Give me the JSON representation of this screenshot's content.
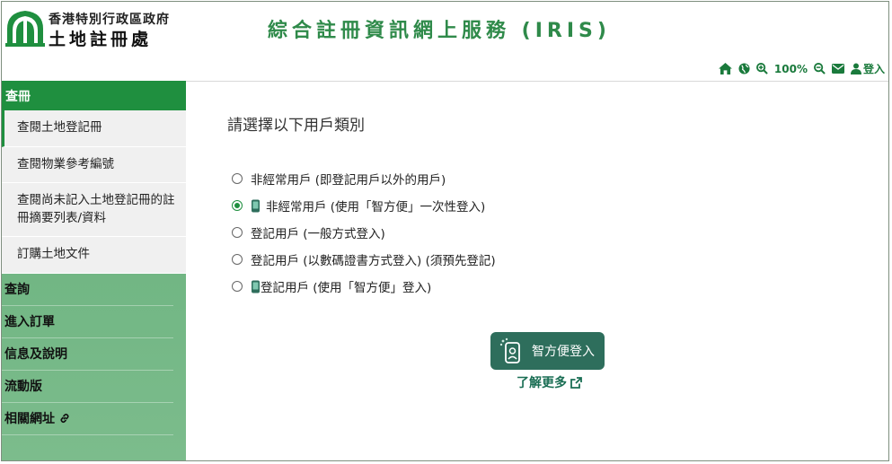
{
  "header": {
    "gov_name": "香港特別行政區政府",
    "dept_name": "土地註冊處",
    "service_title": "綜合註冊資訊網上服務 (IRIS)"
  },
  "toolbar": {
    "items": [
      {
        "icon": "home-icon"
      },
      {
        "icon": "globe-icon"
      },
      {
        "icon": "zoom-in-icon"
      },
      {
        "label": "100%"
      },
      {
        "icon": "zoom-out-icon"
      },
      {
        "icon": "mail-icon"
      },
      {
        "icon": "user-icon",
        "label": "登入"
      }
    ],
    "zoom_level": "100%",
    "login_label": "登入"
  },
  "sidebar": {
    "section": "查冊",
    "sub_items": [
      {
        "label": "查閱土地登記冊",
        "active": true
      },
      {
        "label": "查閱物業參考編號"
      },
      {
        "label": "查閱尚未記入土地登記冊的註冊摘要列表/資料"
      },
      {
        "label": "訂購土地文件"
      }
    ],
    "main_items": [
      {
        "label": "查詢"
      },
      {
        "label": "進入訂單"
      },
      {
        "label": "信息及說明"
      },
      {
        "label": "流動版"
      },
      {
        "label": "相關網址",
        "icon": "link-icon"
      }
    ]
  },
  "main": {
    "prompt": "請選擇以下用戶類別",
    "options": [
      {
        "label": "非經常用戶 (即登記用戶以外的用戶)",
        "checked": false,
        "icon": null
      },
      {
        "label": "非經常用戶 (使用「智方便」一次性登入)",
        "checked": true,
        "icon": "iamsmart-icon"
      },
      {
        "label": "登記用戶 (一般方式登入)",
        "checked": false,
        "icon": null
      },
      {
        "label": "登記用戶 (以數碼證書方式登入) (須預先登記)",
        "checked": false,
        "icon": null
      },
      {
        "label": "登記用戶 (使用「智方便」登入)",
        "checked": false,
        "icon": "iamsmart-icon"
      }
    ],
    "iamsmart_button": "智方便登入",
    "learn_more": "了解更多"
  },
  "colors": {
    "brand_green": "#1f8f3f",
    "title_green": "#2f8a4a",
    "iamsmart_teal": "#2e6e5c"
  }
}
